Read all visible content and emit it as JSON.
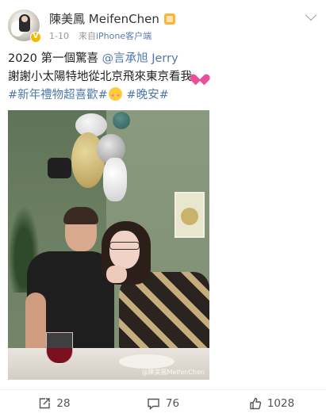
{
  "post": {
    "username": "陳美鳳 MeifenChen",
    "time": "1-10",
    "source_prefix": "来自",
    "source_device": "iPhone客户端",
    "line1_text": "2020 第一個驚喜 ",
    "line1_mention": "@言承旭 Jerry",
    "line2_text": "謝謝小太陽特地從北京飛來東京看我",
    "line3_tag1": "#新年禮物超喜歡#",
    "line3_tag2": " #晚安#",
    "photo_watermark": "@陳美鳳MeifenChen"
  },
  "icons": {
    "menu": "chevron-down-icon",
    "verified": "verified-badge-icon",
    "member": "member-crown-icon",
    "heart_emoji": "sparkling-heart-emoji",
    "face_emoji": "smiling-face-with-hearts-emoji",
    "repost": "repost-icon",
    "comment": "comment-icon",
    "like": "thumbs-up-icon"
  },
  "actions": {
    "repost_count": "28",
    "comment_count": "76",
    "like_count": "1028"
  },
  "colors": {
    "link": "#4f79a7",
    "verified": "#f5b800",
    "member": "#f8b53a"
  }
}
